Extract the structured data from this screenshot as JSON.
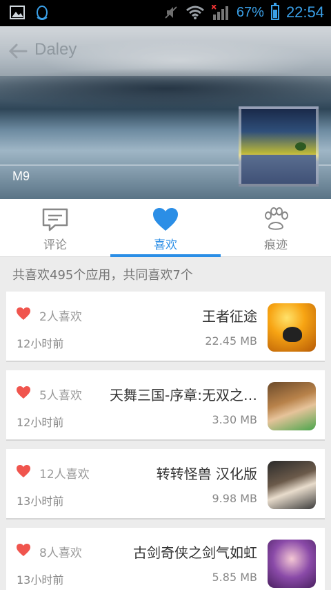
{
  "status_bar": {
    "battery_text": "67%",
    "battery_level": 0.67,
    "time": "22:54",
    "icons": [
      "image-icon",
      "qq-icon",
      "mute-icon",
      "wifi-icon",
      "signal-icon",
      "battery-icon"
    ]
  },
  "header": {
    "title": "Daley",
    "hero_label": "M9"
  },
  "tabs": [
    {
      "label": "评论",
      "icon": "comment-icon",
      "active": false
    },
    {
      "label": "喜欢",
      "icon": "heart-icon",
      "active": true
    },
    {
      "label": "痕迹",
      "icon": "paw-icon",
      "active": false
    }
  ],
  "summary": "共喜欢495个应用，共同喜欢7个",
  "apps": [
    {
      "likes": "2人喜欢",
      "name": "王者征途",
      "time": "12小时前",
      "size": "22.45 MB"
    },
    {
      "likes": "5人喜欢",
      "name": "天舞三国-序章:无双之…",
      "time": "12小时前",
      "size": "3.30 MB"
    },
    {
      "likes": "12人喜欢",
      "name": "转转怪兽 汉化版",
      "time": "13小时前",
      "size": "9.98 MB"
    },
    {
      "likes": "8人喜欢",
      "name": "古剑奇侠之剑气如虹",
      "time": "13小时前",
      "size": "5.85 MB"
    }
  ],
  "colors": {
    "accent": "#2b8ee6",
    "heart": "#f0554e",
    "status_text": "#3aa0e8"
  }
}
